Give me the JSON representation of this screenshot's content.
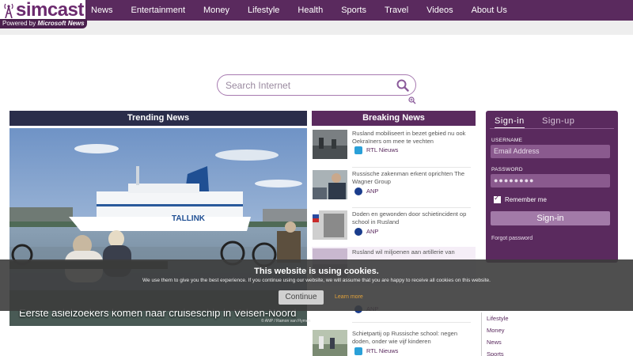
{
  "brand": {
    "name": "simcast",
    "powered_prefix": "Powered by ",
    "powered_name": "Microsoft News",
    "color": "#5a2a5e"
  },
  "nav": {
    "items": [
      "News",
      "Entertainment",
      "Money",
      "Lifestyle",
      "Health",
      "Sports",
      "Travel",
      "Videos",
      "About Us"
    ]
  },
  "search": {
    "placeholder": "Search Internet"
  },
  "trending": {
    "header": "Trending News",
    "caption": "Eerste asielzoekers komen naar cruiseschip in Velsen-Noord",
    "credit": "© ANP / Ramon van Flymen",
    "ship_text": "TALLINK"
  },
  "breaking": {
    "header": "Breaking News",
    "items": [
      {
        "title": "Rusland mobiliseert in bezet gebied nu ook Oekraïners om mee te vechten",
        "source": "RTL Nieuws",
        "source_icon": "rtl-icon"
      },
      {
        "title": "Russische zakenman erkent oprichten The Wagner Group",
        "source": "ANP",
        "source_icon": "anp-icon"
      },
      {
        "title": "Doden en gewonden door schietincident op school in Rusland",
        "source": "ANP",
        "source_icon": "anp-icon"
      },
      {
        "title": "Rusland wil miljoenen aan artillerie van",
        "source": "",
        "source_icon": ""
      },
      {
        "title": "",
        "source": "ANP",
        "source_icon": "anp-icon"
      },
      {
        "title": "Schietpartij op Russische school: negen doden, onder wie vijf kinderen",
        "source": "RTL Nieuws",
        "source_icon": "rtl-icon"
      }
    ]
  },
  "signin": {
    "tab_signin": "Sign-in",
    "tab_signup": "Sign-up",
    "username_label": "USERNAME",
    "username_placeholder": "Email Address",
    "password_label": "PASSWORD",
    "password_value": "●●●●●●●●",
    "remember_label": "Remember me",
    "remember_checked": true,
    "button": "Sign-in",
    "forgot": "Forgot password"
  },
  "side_links": [
    "Lifestyle",
    "Money",
    "News",
    "Sports"
  ],
  "cookie": {
    "title": "This website is using cookies.",
    "text": "We use them to give you the best experience. If you continue using our website, we will assume that you are happy to receive all cookies on this website.",
    "continue": "Continue",
    "learn_more": "Learn more"
  }
}
